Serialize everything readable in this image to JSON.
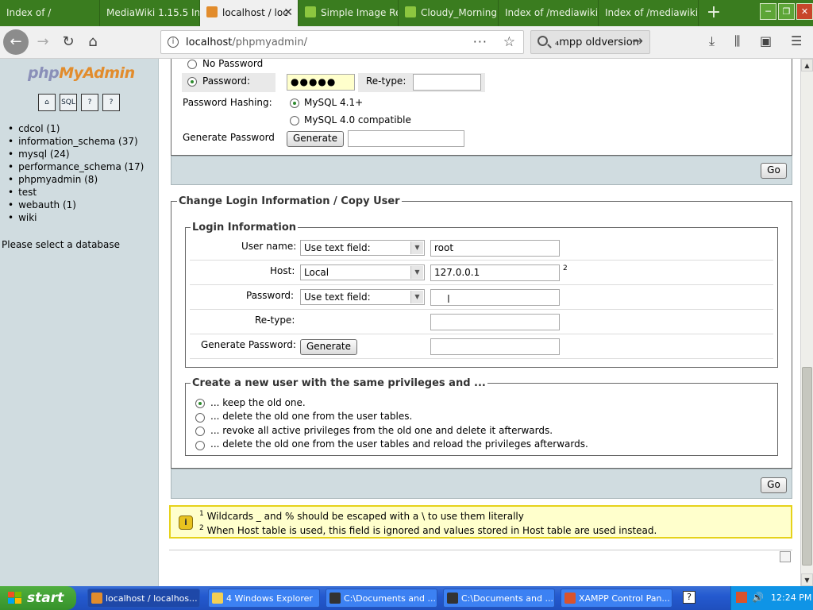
{
  "browser": {
    "tabs": [
      {
        "label": "Index of /",
        "color": "#3a7c1f"
      },
      {
        "label": "MediaWiki 1.15.5 Ins",
        "color": "#3a7c1f"
      },
      {
        "label": "localhost / loc",
        "color": "#f0f0f0"
      },
      {
        "label": "Simple Image Re",
        "color": "#3a7c1f"
      },
      {
        "label": "Cloudy_Morning",
        "color": "#3a7c1f"
      },
      {
        "label": "Index of /mediawiki/",
        "color": "#3a7c1f"
      },
      {
        "label": "Index of /mediawiki/1",
        "color": "#3a7c1f"
      }
    ],
    "url_host": "localhost",
    "url_path": "/phpmyadmin/",
    "search_text": "₄mpp oldversion",
    "dots": "···"
  },
  "sidebar": {
    "logo": {
      "php": "php",
      "my": "My",
      "admin": "Admin"
    },
    "icons": [
      "home-icon",
      "sql-icon",
      "query-icon",
      "docs-icon"
    ],
    "sql_icon_text": "SQL",
    "databases": [
      "cdcol (1)",
      "information_schema (37)",
      "mysql (24)",
      "performance_schema (17)",
      "phpmyadmin (8)",
      "test",
      "webauth (1)",
      "wiki"
    ],
    "select_db": "Please select a database"
  },
  "password_section": {
    "no_password": "No Password",
    "password_label": "Password:",
    "password_value": "●●●●●",
    "retype_label": "Re-type:",
    "hashing_label": "Password Hashing:",
    "hash_option1": "MySQL 4.1+",
    "hash_option2": "MySQL 4.0 compatible",
    "generate_label": "Generate Password",
    "generate_button": "Generate",
    "go_button": "Go"
  },
  "change_login": {
    "legend": "Change Login Information / Copy User",
    "login_legend": "Login Information",
    "username_label": "User name:",
    "username_select": "Use text field:",
    "username_value": "root",
    "host_label": "Host:",
    "host_select": "Local",
    "host_value": "127.0.0.1",
    "host_footnote": "2",
    "password_label": "Password:",
    "password_select": "Use text field:",
    "retype_label": "Re-type:",
    "generate_label": "Generate Password:",
    "generate_button": "Generate"
  },
  "copy_user": {
    "legend": "Create a new user with the same privileges and ...",
    "options": [
      "... keep the old one.",
      "... delete the old one from the user tables.",
      "... revoke all active privileges from the old one and delete it afterwards.",
      "... delete the old one from the user tables and reload the privileges afterwards."
    ],
    "go_button": "Go"
  },
  "notice": {
    "icon": "i",
    "sup1": "1",
    "line1": "Wildcards _ and % should be escaped with a \\ to use them literally",
    "sup2": "2",
    "line2": "When Host table is used, this field is ignored and values stored in Host table are used instead."
  },
  "taskbar": {
    "start": "start",
    "tasks": [
      "localhost / localhos...",
      "4 Windows Explorer",
      "C:\\Documents and ...",
      "C:\\Documents and ...",
      "XAMPP Control Pan..."
    ],
    "time": "12:24 PM"
  }
}
